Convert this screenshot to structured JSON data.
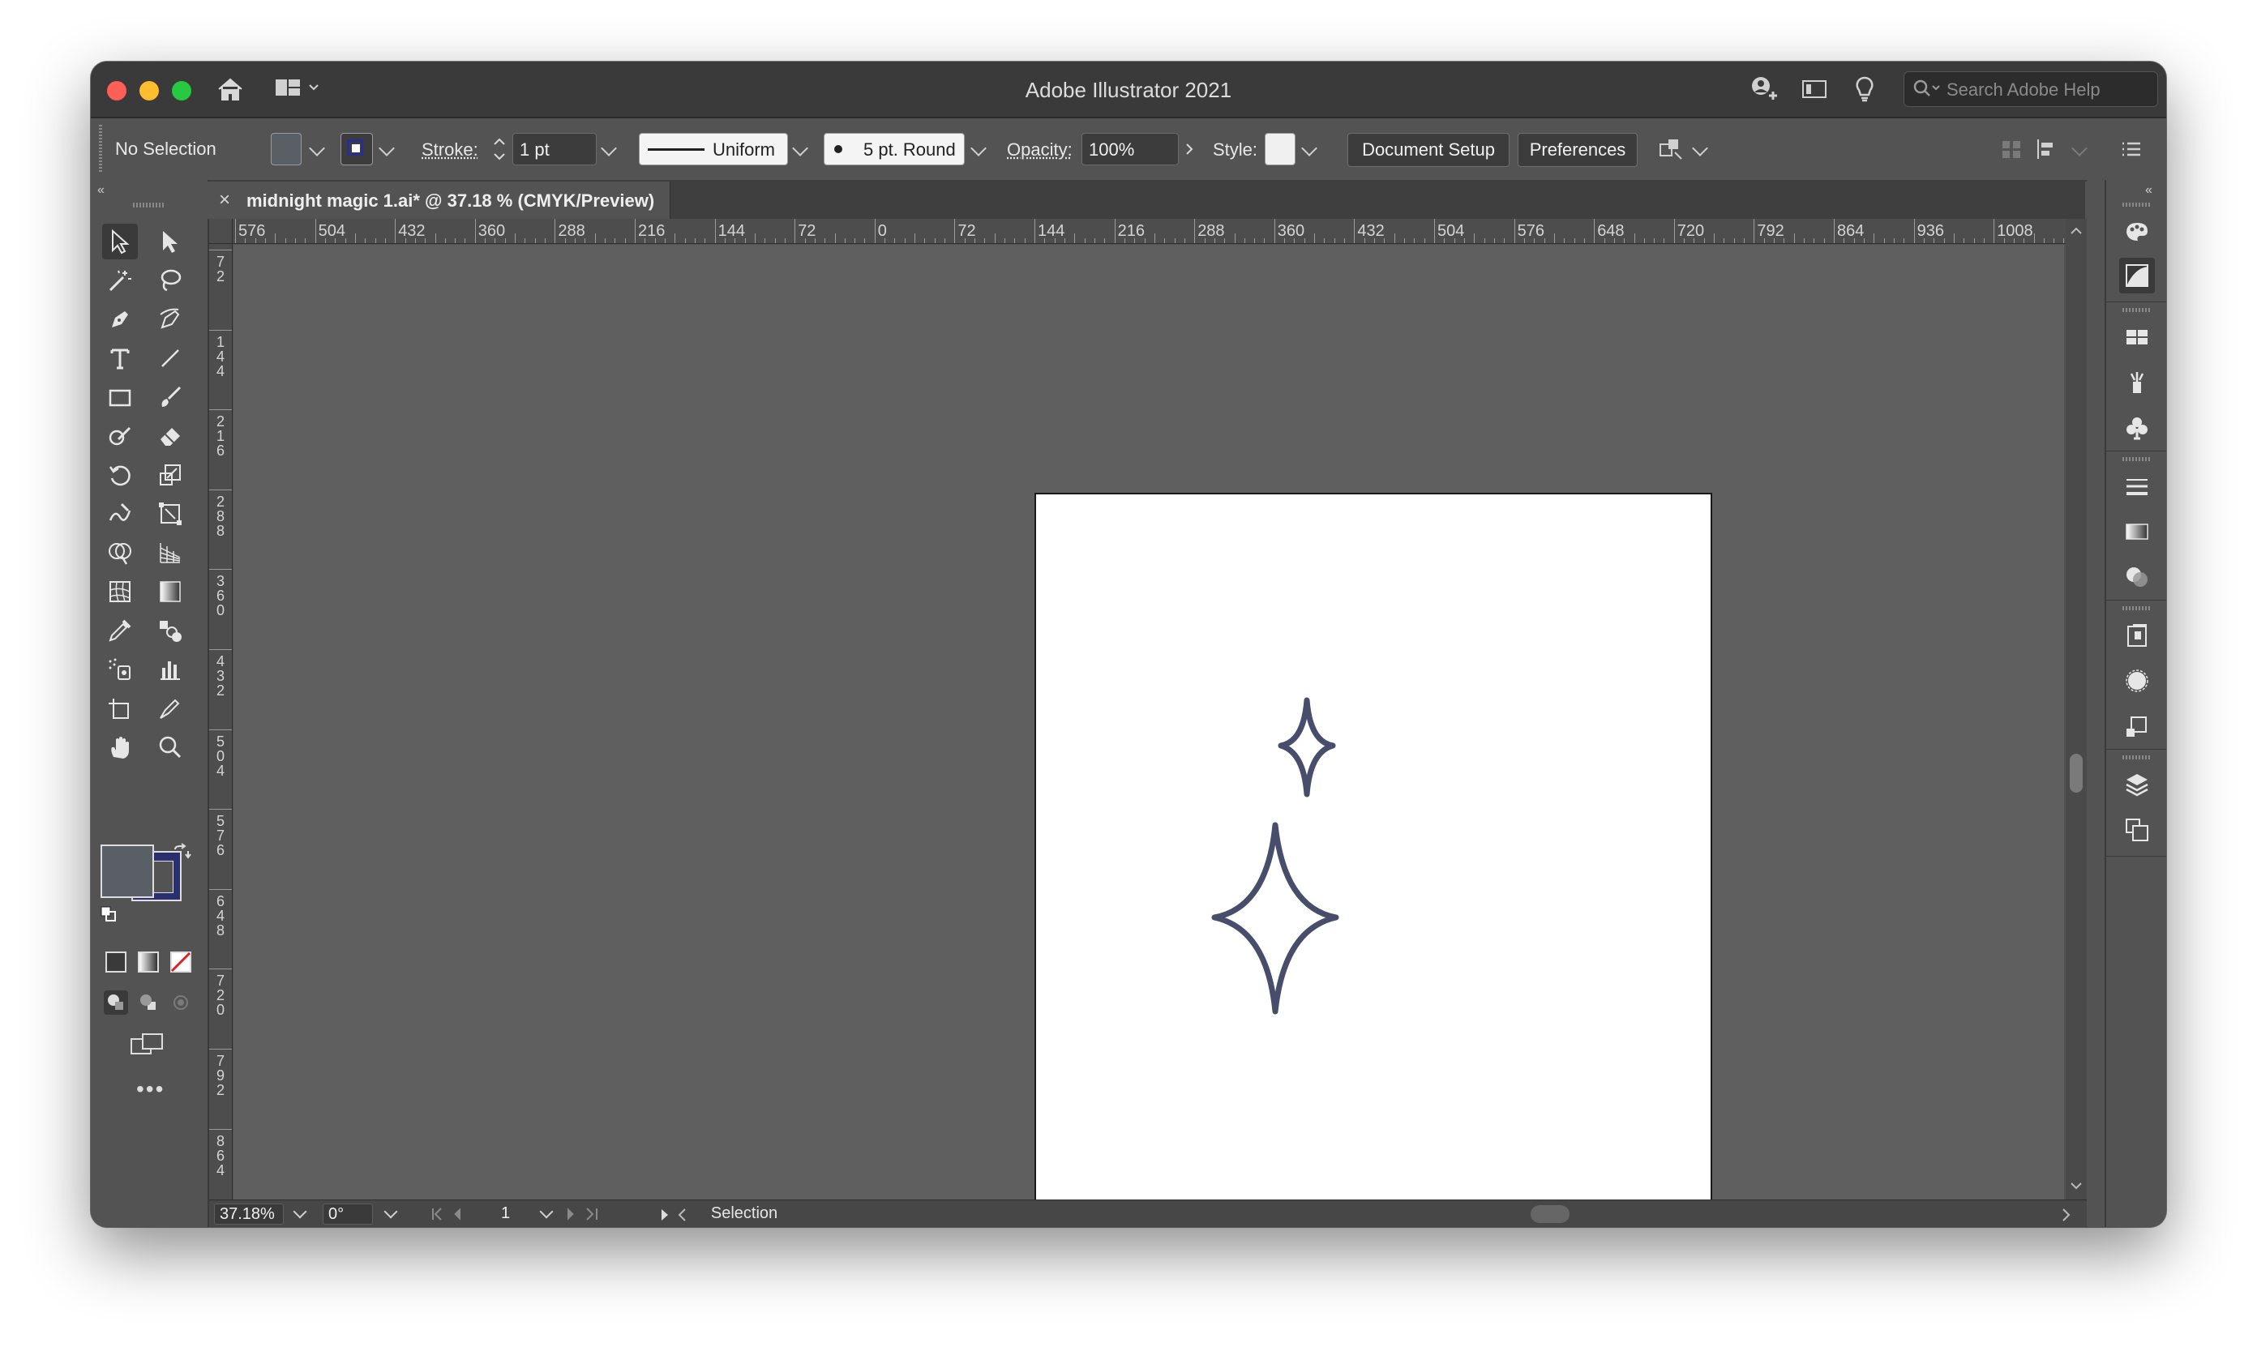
{
  "window": {
    "title": "Adobe Illustrator 2021",
    "search_placeholder": "Search Adobe Help"
  },
  "control_bar": {
    "selection_state": "No Selection",
    "stroke_label": "Stroke:",
    "stroke_weight": "1 pt",
    "stroke_profile": "Uniform",
    "brush": "5 pt. Round",
    "opacity_label": "Opacity:",
    "opacity_value": "100%",
    "style_label": "Style:",
    "document_setup_button": "Document Setup",
    "preferences_button": "Preferences"
  },
  "document_tab": {
    "close": "×",
    "label": "midnight magic 1.ai* @ 37.18 % (CMYK/Preview)"
  },
  "ruler_top": [
    "576",
    "504",
    "432",
    "360",
    "288",
    "216",
    "144",
    "72",
    "0",
    "72",
    "144",
    "216",
    "288",
    "360",
    "432",
    "504",
    "576",
    "648",
    "720",
    "792",
    "864",
    "936",
    "1008"
  ],
  "ruler_left": [
    "72",
    "144",
    "216",
    "288",
    "360",
    "432",
    "504",
    "576",
    "648",
    "720",
    "792",
    "864"
  ],
  "status_bar": {
    "zoom": "37.18%",
    "rotation": "0°",
    "artboard_number": "1",
    "tool_name": "Selection"
  },
  "colors": {
    "fill_swatch": "#5a5f66",
    "stroke_swatch": "#2a2f6e",
    "sparkle_stroke": "#474d6b"
  },
  "tools": [
    "selection-tool",
    "direct-selection-tool",
    "magic-wand-tool",
    "lasso-tool",
    "pen-tool",
    "curvature-tool",
    "type-tool",
    "line-segment-tool",
    "rectangle-tool",
    "paintbrush-tool",
    "shaper-tool",
    "eraser-tool",
    "rotate-tool",
    "scale-tool",
    "warp-tool",
    "free-transform-tool",
    "shape-builder-tool",
    "perspective-grid-tool",
    "mesh-tool",
    "gradient-tool",
    "eyedropper-tool",
    "blend-tool",
    "symbol-sprayer-tool",
    "column-graph-tool",
    "artboard-tool",
    "slice-tool",
    "hand-tool",
    "zoom-tool"
  ]
}
